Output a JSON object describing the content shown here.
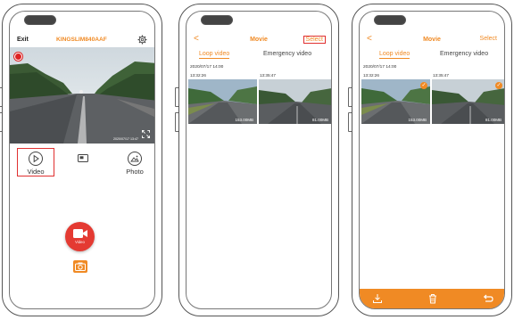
{
  "screen1": {
    "exit_label": "Exit",
    "device_name": "KINGSLIM840AAF",
    "timestamp": "2020/07/17 13:47",
    "video_label": "Video",
    "photo_label": "Photo",
    "record_button_label": "Video",
    "icons": [
      "gear-icon",
      "play-circle-icon",
      "card-icon",
      "photo-icon",
      "fullscreen-icon",
      "video-camera-icon",
      "camera-icon"
    ]
  },
  "screen2": {
    "back_label": "<",
    "title": "Movie",
    "select_label": "Select",
    "tabs": [
      "Loop video",
      "Emergency video"
    ],
    "date": "2020/07/17 14:00",
    "files": [
      {
        "time": "13:32:26",
        "size": "153.00MB"
      },
      {
        "time": "13:35:47",
        "size": "81.00MB"
      }
    ]
  },
  "screen3": {
    "back_label": "<",
    "title": "Movie",
    "select_label": "Select",
    "tabs": [
      "Loop video",
      "Emergency video"
    ],
    "date": "2020/07/17 14:00",
    "files": [
      {
        "time": "13:32:26",
        "size": "153.00MB",
        "selected": true
      },
      {
        "time": "13:35:47",
        "size": "81.00MB",
        "selected": true
      }
    ],
    "toolbar_icons": [
      "download-icon",
      "trash-icon",
      "back-arrow-icon"
    ]
  },
  "colors": {
    "accent": "#f08a24",
    "highlight": "#e03030",
    "record": "#e43a32"
  }
}
